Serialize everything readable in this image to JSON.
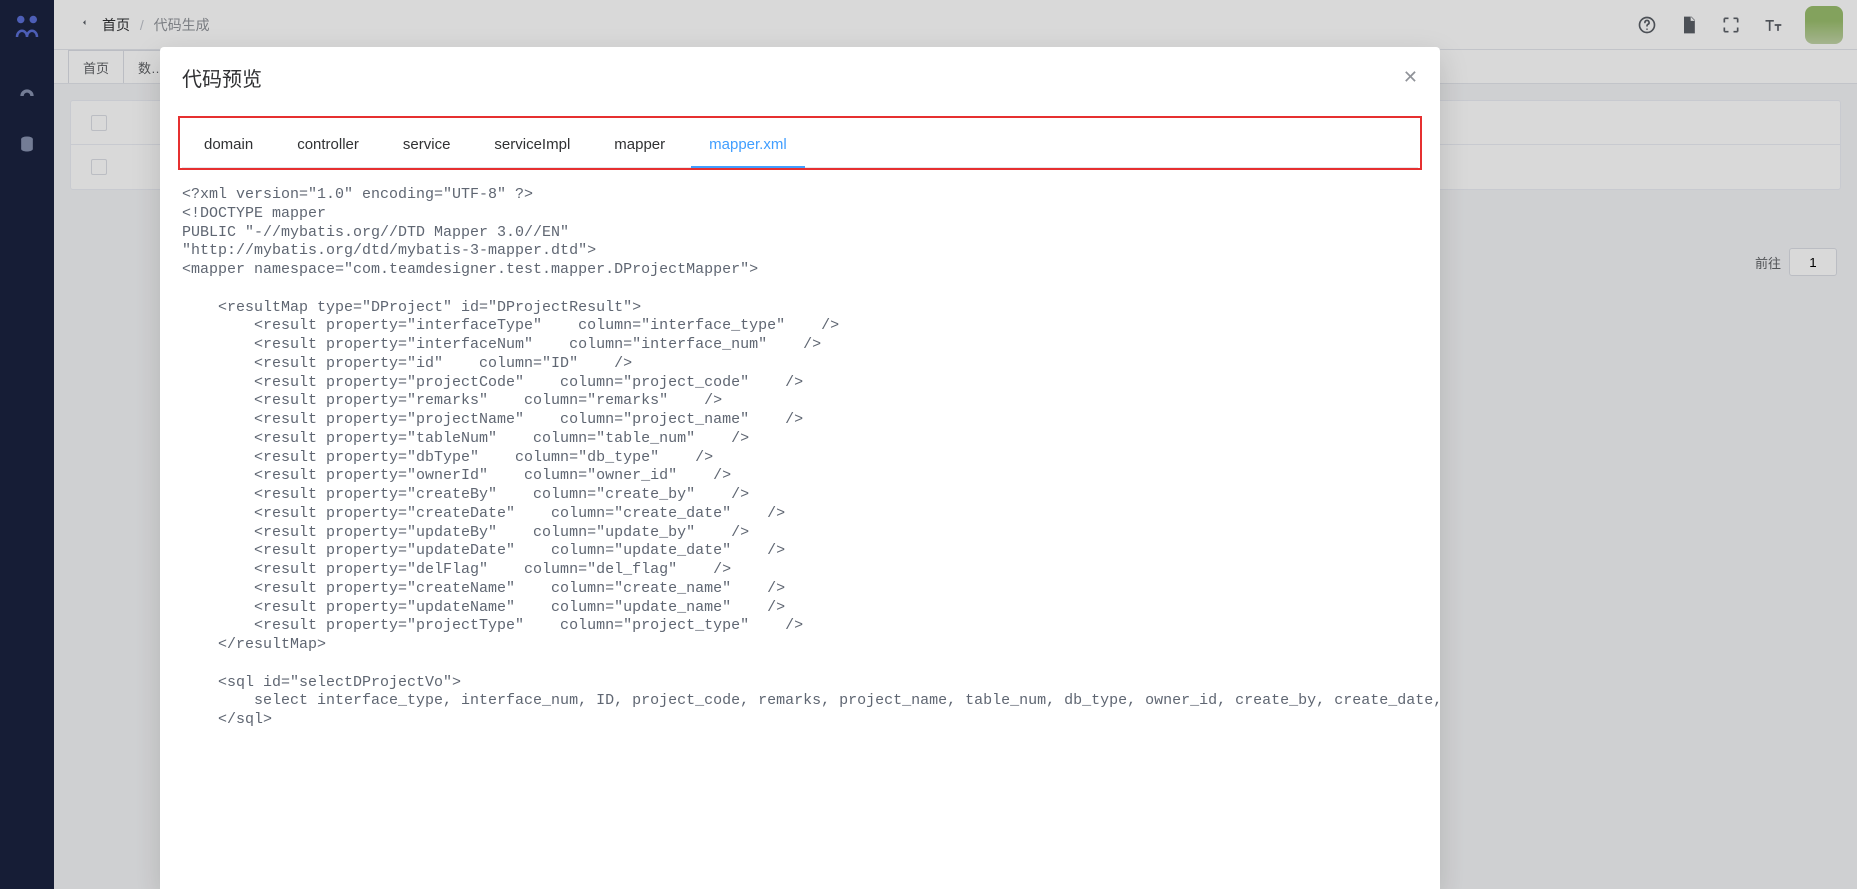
{
  "breadcrumb": {
    "home": "首页",
    "current": "代码生成"
  },
  "page_tabs": [
    {
      "label": "首页"
    },
    {
      "label": "数…"
    }
  ],
  "pager": {
    "goto_label": "前往",
    "page": "1"
  },
  "modal": {
    "title": "代码预览",
    "tabs": [
      "domain",
      "controller",
      "service",
      "serviceImpl",
      "mapper",
      "mapper.xml"
    ],
    "active_tab_index": 5,
    "code": "<?xml version=\"1.0\" encoding=\"UTF-8\" ?>\n<!DOCTYPE mapper\nPUBLIC \"-//mybatis.org//DTD Mapper 3.0//EN\"\n\"http://mybatis.org/dtd/mybatis-3-mapper.dtd\">\n<mapper namespace=\"com.teamdesigner.test.mapper.DProjectMapper\">\n\n    <resultMap type=\"DProject\" id=\"DProjectResult\">\n        <result property=\"interfaceType\"    column=\"interface_type\"    />\n        <result property=\"interfaceNum\"    column=\"interface_num\"    />\n        <result property=\"id\"    column=\"ID\"    />\n        <result property=\"projectCode\"    column=\"project_code\"    />\n        <result property=\"remarks\"    column=\"remarks\"    />\n        <result property=\"projectName\"    column=\"project_name\"    />\n        <result property=\"tableNum\"    column=\"table_num\"    />\n        <result property=\"dbType\"    column=\"db_type\"    />\n        <result property=\"ownerId\"    column=\"owner_id\"    />\n        <result property=\"createBy\"    column=\"create_by\"    />\n        <result property=\"createDate\"    column=\"create_date\"    />\n        <result property=\"updateBy\"    column=\"update_by\"    />\n        <result property=\"updateDate\"    column=\"update_date\"    />\n        <result property=\"delFlag\"    column=\"del_flag\"    />\n        <result property=\"createName\"    column=\"create_name\"    />\n        <result property=\"updateName\"    column=\"update_name\"    />\n        <result property=\"projectType\"    column=\"project_type\"    />\n    </resultMap>\n\n    <sql id=\"selectDProjectVo\">\n        select interface_type, interface_num, ID, project_code, remarks, project_name, table_num, db_type, owner_id, create_by, create_date, update_by, upd\n    </sql>"
  }
}
